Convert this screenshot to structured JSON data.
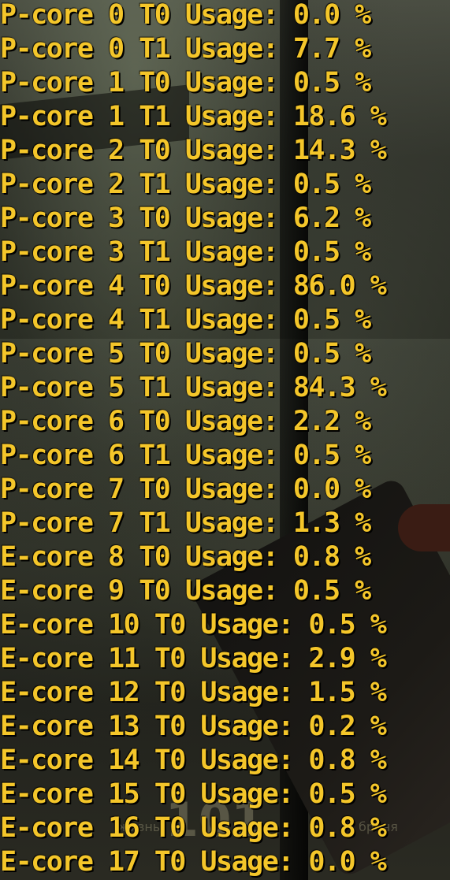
{
  "overlay": {
    "rows": [
      "P-core 0 T0 Usage: 0.0 %",
      "P-core 0 T1 Usage: 7.7 %",
      "P-core 1 T0 Usage: 0.5 %",
      "P-core 1 T1 Usage: 18.6 %",
      "P-core 2 T0 Usage: 14.3 %",
      "P-core 2 T1 Usage: 0.5 %",
      "P-core 3 T0 Usage: 6.2 %",
      "P-core 3 T1 Usage: 0.5 %",
      "P-core 4 T0 Usage: 86.0 %",
      "P-core 4 T1 Usage: 0.5 %",
      "P-core 5 T0 Usage: 0.5 %",
      "P-core 5 T1 Usage: 84.3 %",
      "P-core 6 T0 Usage: 2.2 %",
      "P-core 6 T1 Usage: 0.5 %",
      "P-core 7 T0 Usage: 0.0 %",
      "P-core 7 T1 Usage: 1.3 %",
      "E-core 8 T0 Usage: 0.8 %",
      "E-core 9 T0 Usage: 0.5 %",
      "E-core 10 T0 Usage: 0.5 %",
      "E-core 11 T0 Usage: 2.9 %",
      "E-core 12 T0 Usage: 1.5 %",
      "E-core 13 T0 Usage: 0.2 %",
      "E-core 14 T0 Usage: 0.8 %",
      "E-core 15 T0 Usage: 0.5 %",
      "E-core 16 T0 Usage: 0.8 %",
      "E-core 17 T0 Usage: 0.0 %"
    ],
    "text_color": "#f4c62a"
  },
  "hud": {
    "health_label": "жизнь",
    "health_value": "101",
    "armor_label": "броня"
  }
}
